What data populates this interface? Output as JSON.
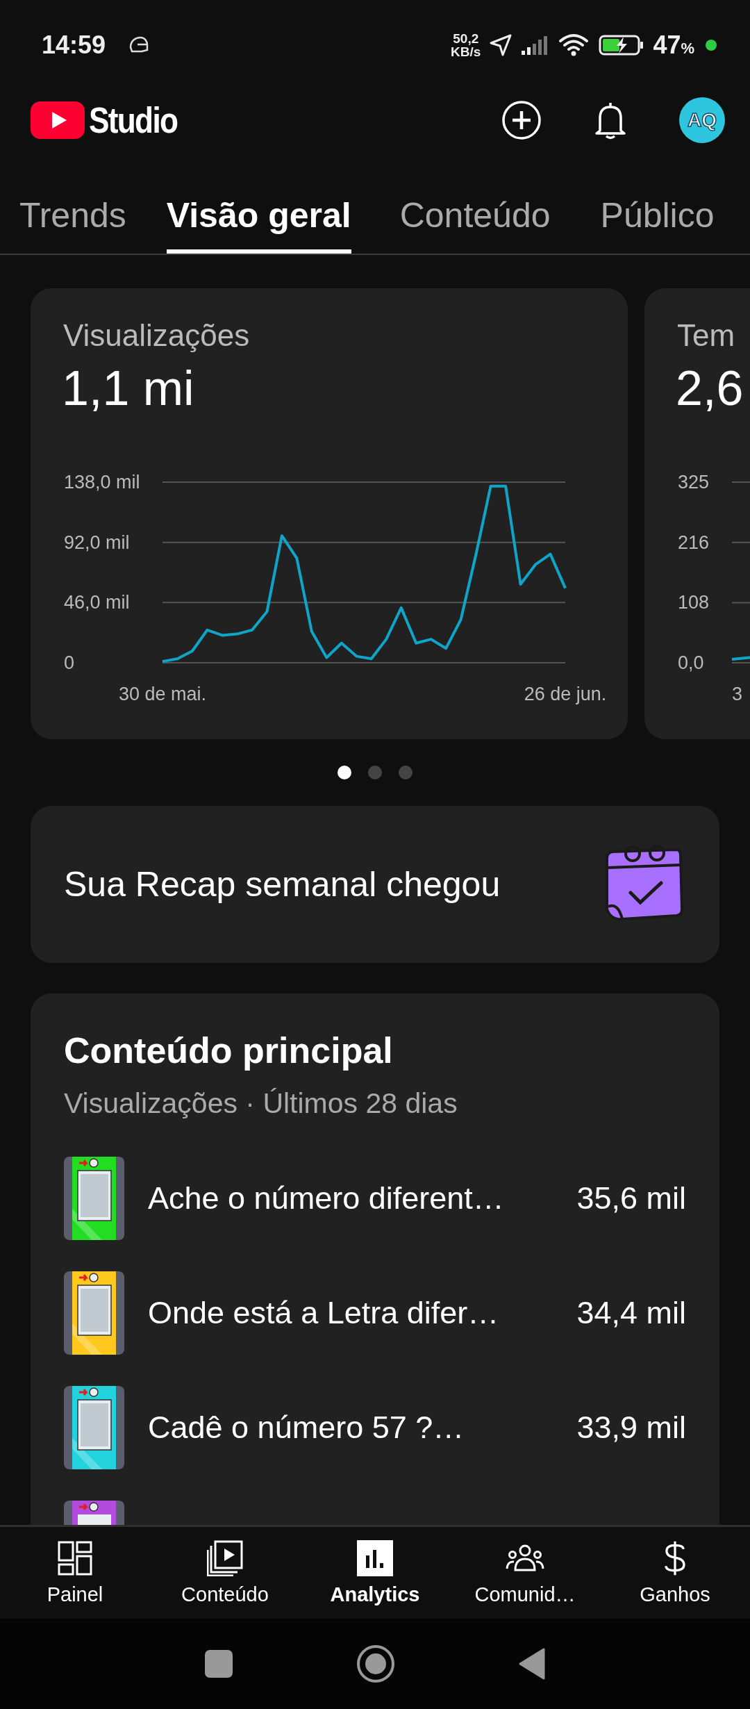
{
  "status_bar": {
    "time": "14:59",
    "net_speed": "50,2",
    "net_unit": "KB/s",
    "battery": "47",
    "battery_unit": "%"
  },
  "header": {
    "logo": "Studio",
    "avatar": "AQ"
  },
  "tabs": [
    {
      "label": "Trends",
      "selected": false
    },
    {
      "label": "Visão geral",
      "selected": true
    },
    {
      "label": "Conteúdo",
      "selected": false
    },
    {
      "label": "Público",
      "selected": false
    }
  ],
  "cards": [
    {
      "title": "Visualizações",
      "value": "1,1 mi",
      "chart_data": {
        "type": "line",
        "categories": [
          "30 de mai.",
          null,
          null,
          null,
          null,
          null,
          null,
          null,
          null,
          null,
          null,
          null,
          null,
          null,
          null,
          null,
          null,
          null,
          null,
          null,
          null,
          null,
          null,
          null,
          null,
          null,
          null,
          "26 de jun."
        ],
        "ylim": [
          0,
          138
        ],
        "series": [
          {
            "color": "#0ea5c8",
            "values": [
              1,
              3,
              9,
              25,
              21,
              22,
              25,
              39,
              97,
              80,
              24,
              4,
              15,
              5,
              3,
              18,
              42,
              15,
              18,
              11,
              33,
              82,
              135,
              135,
              60,
              75,
              83,
              57
            ]
          }
        ],
        "yticks": [
          {
            "value": 138,
            "label": "138,0 mil"
          },
          {
            "value": 92,
            "label": "92,0 mil"
          },
          {
            "value": 46,
            "label": "46,0 mil"
          },
          {
            "value": 0,
            "label": "0"
          }
        ]
      }
    },
    {
      "title": "Tem",
      "value": "2,6",
      "axis_labels": [
        "325",
        "216",
        "108",
        "0,0"
      ],
      "date_label": "3"
    }
  ],
  "pager": [
    {
      "selected": true
    },
    {
      "selected": false
    },
    {
      "selected": false
    }
  ],
  "recap": {
    "text": "Sua Recap semanal chegou"
  },
  "top_content": {
    "title": "Conteúdo principal",
    "subtitle": "Visualizações · Últimos 28 dias",
    "more_below": true,
    "items": [
      {
        "title": "Ache o número diferent…",
        "views": "35,6 mil"
      },
      {
        "title": "Onde está a Letra difer…",
        "views": "34,4 mil"
      },
      {
        "title": "Cadê o número 57 ?…",
        "views": "33,9 mil"
      }
    ]
  },
  "bottom_nav": [
    {
      "kind": "dashboard",
      "label": "Painel",
      "selected": false
    },
    {
      "kind": "content",
      "label": "Conteúdo",
      "selected": false
    },
    {
      "kind": "analytics",
      "label": "Analytics",
      "selected": true
    },
    {
      "kind": "community",
      "label": "Comunid…",
      "selected": false
    },
    {
      "kind": "earnings",
      "label": "Ganhos",
      "selected": false
    }
  ]
}
